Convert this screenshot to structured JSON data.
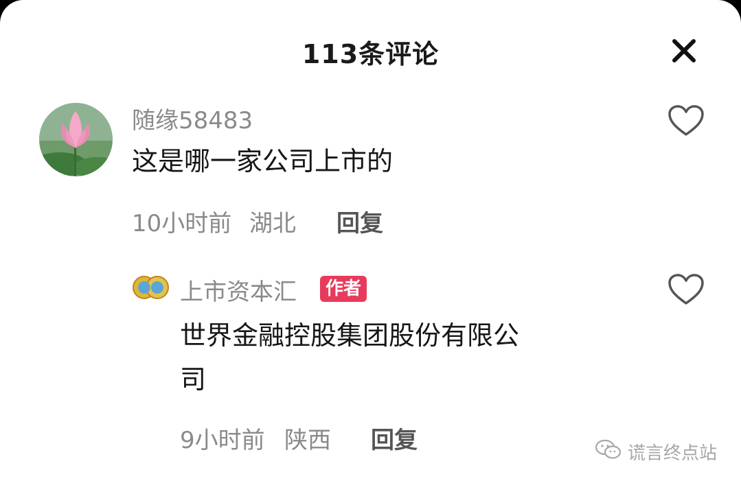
{
  "header": {
    "title": "113条评论",
    "close_icon": "close-icon"
  },
  "comments": [
    {
      "username": "随缘58483",
      "text": "这是哪一家公司上市的",
      "time": "10小时前",
      "location": "湖北",
      "reply_label": "回复",
      "avatar_icon": "lotus-avatar",
      "like_icon": "heart-outline-icon"
    },
    {
      "username": "上市资本汇",
      "badge": "作者",
      "text_line1": "世界金融控股集团股份有限公",
      "text_line2": "司",
      "time": "9小时前",
      "location": "陕西",
      "reply_label": "回复",
      "avatar_icon": "gold-coin-avatar",
      "like_icon": "heart-outline-icon"
    }
  ],
  "watermark": {
    "text": "谎言终点站",
    "icon": "wechat-icon"
  },
  "colors": {
    "badge": "#e83a5c",
    "muted_text": "#8a8a8a",
    "primary_text": "#161616",
    "background": "#ffffff"
  }
}
